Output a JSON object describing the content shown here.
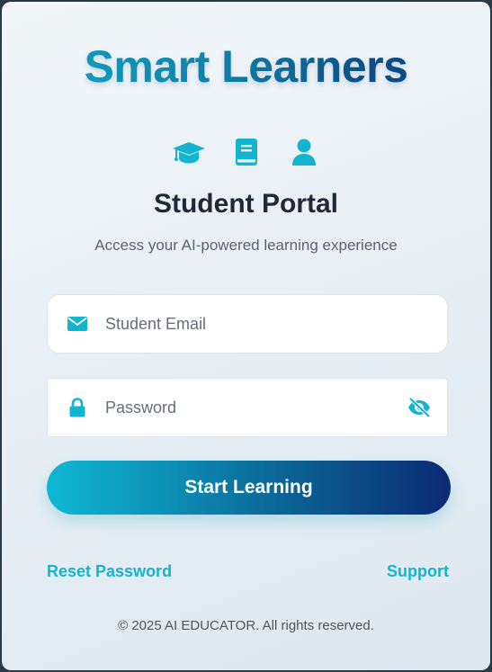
{
  "brand": {
    "name": "Smart Learners"
  },
  "header_icons": [
    "graduation-cap-icon",
    "book-icon",
    "user-icon"
  ],
  "portal": {
    "title": "Student Portal",
    "subtitle": "Access your AI-powered learning experience"
  },
  "form": {
    "email": {
      "placeholder": "Student Email",
      "value": "",
      "icon": "envelope-icon"
    },
    "password": {
      "placeholder": "Password",
      "value": "",
      "icon": "lock-icon",
      "toggle_icon": "eye-slash-icon"
    },
    "submit_label": "Start Learning"
  },
  "links": {
    "reset": "Reset Password",
    "support": "Support"
  },
  "footer": {
    "copyright": "© 2025 AI EDUCATOR. All rights reserved."
  },
  "colors": {
    "accent": "#13b4cf",
    "brand_dark": "#0b2a74",
    "title_text": "#1f2937"
  }
}
